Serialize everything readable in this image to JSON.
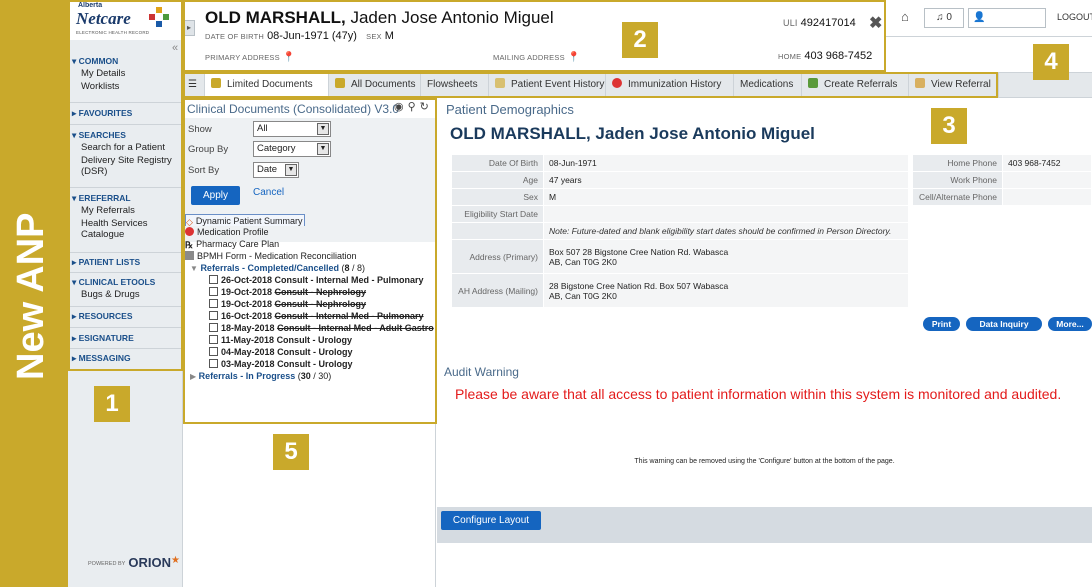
{
  "banner": {
    "text": "New ANP"
  },
  "logo": {
    "province": "Alberta",
    "brand": "Netcare",
    "tagline": "ELECTRONIC HEALTH RECORD"
  },
  "labels": [
    "1",
    "2",
    "3",
    "4",
    "5"
  ],
  "nav": {
    "collapse_glyph": "«",
    "sections": [
      {
        "head": "COMMON",
        "expanded": true,
        "items": [
          "My Details",
          "Worklists"
        ]
      },
      {
        "head": "FAVOURITES",
        "expanded": false,
        "items": []
      },
      {
        "head": "SEARCHES",
        "expanded": true,
        "items": [
          "Search for a Patient",
          "Delivery Site Registry (DSR)"
        ]
      },
      {
        "head": "EREFERRAL",
        "expanded": true,
        "items": [
          "My Referrals",
          "Health Services Catalogue"
        ]
      },
      {
        "head": "PATIENT LISTS",
        "expanded": false,
        "items": []
      },
      {
        "head": "CLINICAL ETOOLS",
        "expanded": true,
        "items": [
          "Bugs & Drugs"
        ]
      },
      {
        "head": "RESOURCES",
        "expanded": false,
        "items": []
      },
      {
        "head": "ESIGNATURE",
        "expanded": false,
        "items": []
      },
      {
        "head": "MESSAGING",
        "expanded": false,
        "items": []
      }
    ]
  },
  "footer_brand": {
    "powered": "POWERED BY",
    "name": "ORION",
    "sub": "HEALTH"
  },
  "header": {
    "last_name": "OLD MARSHALL,",
    "given_names": "Jaden Jose Antonio Miguel",
    "dob_label": "DATE OF BIRTH",
    "dob_value": "08-Jun-1971 (47y)",
    "sex_label": "SEX",
    "sex_value": "M",
    "primary_address_label": "PRIMARY ADDRESS",
    "mailing_address_label": "MAILING ADDRESS",
    "home_label": "HOME",
    "home_value": "403 968-7452",
    "uli_label": "ULI",
    "uli_value": "492417014",
    "close_glyph": "✖"
  },
  "toptools": {
    "bell_count": "0",
    "logout": "LOGOUT"
  },
  "tabs": [
    {
      "label": "Limited Documents",
      "icon": "document-icon",
      "color": "#c9a92b"
    },
    {
      "label": "All Documents",
      "icon": "documents-icon",
      "color": "#c9a92b"
    },
    {
      "label": "Flowsheets",
      "icon": "",
      "color": ""
    },
    {
      "label": "Patient Event History",
      "icon": "history-icon",
      "color": "#d8c070"
    },
    {
      "label": "Immunization History",
      "icon": "immunization-icon",
      "color": "#d33"
    },
    {
      "label": "Medications",
      "icon": "",
      "color": ""
    },
    {
      "label": "Create Referrals",
      "icon": "create-referral-icon",
      "color": "#5a9a3a"
    },
    {
      "label": "View Referral",
      "icon": "view-referral-icon",
      "color": "#d8b060"
    }
  ],
  "docs": {
    "title": "Clinical Documents (Consolidated) V3.0",
    "show_label": "Show",
    "show_value": "All",
    "group_label": "Group By",
    "group_value": "Category",
    "sort_label": "Sort By",
    "sort_value": "Date",
    "apply": "Apply",
    "cancel": "Cancel",
    "top_items": [
      "Dynamic Patient Summary",
      "Medication Profile",
      "Pharmacy Care Plan",
      "BPMH Form - Medication Reconciliation"
    ],
    "group1": {
      "name": "Referrals - Completed/Cancelled",
      "count_a": "8",
      "count_b": "/ 8)"
    },
    "documents": [
      {
        "date": "26-Oct-2018",
        "title": "Consult - Internal Med - Pulmonary",
        "struck": false
      },
      {
        "date": "19-Oct-2018",
        "title": "Consult - Nephrology",
        "struck": true
      },
      {
        "date": "19-Oct-2018",
        "title": "Consult - Nephrology",
        "struck": true
      },
      {
        "date": "16-Oct-2018",
        "title": "Consult - Internal Med - Pulmonary",
        "struck": true
      },
      {
        "date": "18-May-2018",
        "title": "Consult - Internal Med - Adult Gastro",
        "struck": true
      },
      {
        "date": "11-May-2018",
        "title": "Consult - Urology",
        "struck": false
      },
      {
        "date": "04-May-2018",
        "title": "Consult - Urology",
        "struck": false
      },
      {
        "date": "03-May-2018",
        "title": "Consult - Urology",
        "struck": false
      }
    ],
    "group2": {
      "name": "Referrals - In Progress",
      "count_a": "30",
      "count_b": "/ 30)"
    }
  },
  "demographics": {
    "section_title": "Patient Demographics",
    "name": "OLD MARSHALL, Jaden Jose Antonio Miguel",
    "rows": [
      {
        "k": "Date Of Birth",
        "v": "08-Jun-1971"
      },
      {
        "k": "Age",
        "v": "47 years"
      },
      {
        "k": "Sex",
        "v": "M"
      },
      {
        "k": "Eligibility Start Date",
        "v": ""
      }
    ],
    "note": "Note: Future-dated and blank eligibility start dates should be confirmed in Person Directory.",
    "address_primary_label": "Address (Primary)",
    "address_primary_1": "Box 507 28 Bigstone Cree Nation Rd. Wabasca",
    "address_primary_2": "AB, Can T0G 2K0",
    "address_mailing_label": "AH Address (Mailing)",
    "address_mailing_1": "28 Bigstone Cree Nation Rd. Box 507 Wabasca",
    "address_mailing_2": "AB, Can T0G 2K0",
    "phones": [
      {
        "k": "Home Phone",
        "v": "403 968-7452"
      },
      {
        "k": "Work Phone",
        "v": ""
      },
      {
        "k": "Cell/Alternate Phone",
        "v": ""
      }
    ],
    "buttons": [
      "Print",
      "Data Inquiry",
      "More..."
    ]
  },
  "audit": {
    "title": "Audit Warning",
    "text": "Please be aware that all access to patient information within this system is monitored and audited.",
    "note": "This warning can be removed using the 'Configure' button at the bottom of the page.",
    "configure": "Configure Layout"
  },
  "colors": {
    "accent": "#c9a92b",
    "primary": "#1565c0",
    "warning": "#e31b1b"
  }
}
